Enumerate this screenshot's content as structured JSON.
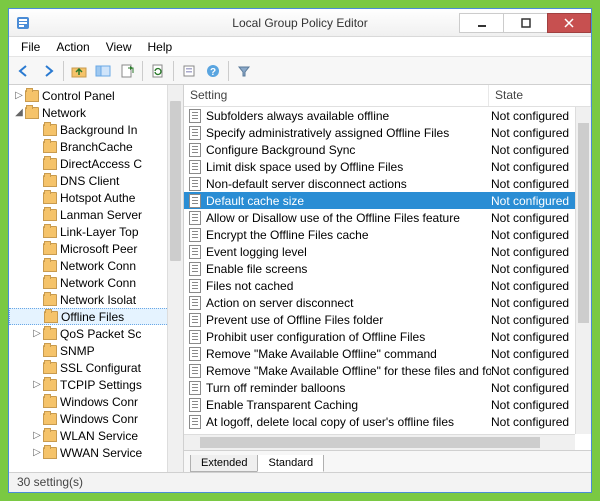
{
  "title": "Local Group Policy Editor",
  "menu": {
    "file": "File",
    "action": "Action",
    "view": "View",
    "help": "Help"
  },
  "toolbar": {
    "back": "back",
    "forward": "forward",
    "up": "up-folder",
    "show": "show-pane",
    "export": "export-list",
    "refresh": "refresh",
    "props": "properties",
    "help": "help",
    "filter": "filter"
  },
  "tree": {
    "items": [
      {
        "label": "Control Panel",
        "exp": "closed",
        "depth": 0,
        "sel": false
      },
      {
        "label": "Network",
        "exp": "open",
        "depth": 0,
        "sel": false
      },
      {
        "label": "Background In",
        "exp": "none",
        "depth": 1,
        "sel": false
      },
      {
        "label": "BranchCache",
        "exp": "none",
        "depth": 1,
        "sel": false
      },
      {
        "label": "DirectAccess C",
        "exp": "none",
        "depth": 1,
        "sel": false
      },
      {
        "label": "DNS Client",
        "exp": "none",
        "depth": 1,
        "sel": false
      },
      {
        "label": "Hotspot Authe",
        "exp": "none",
        "depth": 1,
        "sel": false
      },
      {
        "label": "Lanman Server",
        "exp": "none",
        "depth": 1,
        "sel": false
      },
      {
        "label": "Link-Layer Top",
        "exp": "none",
        "depth": 1,
        "sel": false
      },
      {
        "label": "Microsoft Peer",
        "exp": "none",
        "depth": 1,
        "sel": false
      },
      {
        "label": "Network Conn",
        "exp": "none",
        "depth": 1,
        "sel": false
      },
      {
        "label": "Network Conn",
        "exp": "none",
        "depth": 1,
        "sel": false
      },
      {
        "label": "Network Isolat",
        "exp": "none",
        "depth": 1,
        "sel": false
      },
      {
        "label": "Offline Files",
        "exp": "none",
        "depth": 1,
        "sel": true
      },
      {
        "label": "QoS Packet Sc",
        "exp": "closed",
        "depth": 1,
        "sel": false
      },
      {
        "label": "SNMP",
        "exp": "none",
        "depth": 1,
        "sel": false
      },
      {
        "label": "SSL Configurat",
        "exp": "none",
        "depth": 1,
        "sel": false
      },
      {
        "label": "TCPIP Settings",
        "exp": "closed",
        "depth": 1,
        "sel": false
      },
      {
        "label": "Windows Conr",
        "exp": "none",
        "depth": 1,
        "sel": false
      },
      {
        "label": "Windows Conr",
        "exp": "none",
        "depth": 1,
        "sel": false
      },
      {
        "label": "WLAN Service",
        "exp": "closed",
        "depth": 1,
        "sel": false
      },
      {
        "label": "WWAN Service",
        "exp": "closed",
        "depth": 1,
        "sel": false
      }
    ]
  },
  "columns": {
    "setting": "Setting",
    "state": "State"
  },
  "rows": [
    {
      "name": "Subfolders always available offline",
      "state": "Not configured",
      "sel": false
    },
    {
      "name": "Specify administratively assigned Offline Files",
      "state": "Not configured",
      "sel": false
    },
    {
      "name": "Configure Background Sync",
      "state": "Not configured",
      "sel": false
    },
    {
      "name": "Limit disk space used by Offline Files",
      "state": "Not configured",
      "sel": false
    },
    {
      "name": "Non-default server disconnect actions",
      "state": "Not configured",
      "sel": false
    },
    {
      "name": "Default cache size",
      "state": "Not configured",
      "sel": true
    },
    {
      "name": "Allow or Disallow use of the Offline Files feature",
      "state": "Not configured",
      "sel": false
    },
    {
      "name": "Encrypt the Offline Files cache",
      "state": "Not configured",
      "sel": false
    },
    {
      "name": "Event logging level",
      "state": "Not configured",
      "sel": false
    },
    {
      "name": "Enable file screens",
      "state": "Not configured",
      "sel": false
    },
    {
      "name": "Files not cached",
      "state": "Not configured",
      "sel": false
    },
    {
      "name": "Action on server disconnect",
      "state": "Not configured",
      "sel": false
    },
    {
      "name": "Prevent use of Offline Files folder",
      "state": "Not configured",
      "sel": false
    },
    {
      "name": "Prohibit user configuration of Offline Files",
      "state": "Not configured",
      "sel": false
    },
    {
      "name": "Remove \"Make Available Offline\" command",
      "state": "Not configured",
      "sel": false
    },
    {
      "name": "Remove \"Make Available Offline\" for these files and folders",
      "state": "Not configured",
      "sel": false
    },
    {
      "name": "Turn off reminder balloons",
      "state": "Not configured",
      "sel": false
    },
    {
      "name": "Enable Transparent Caching",
      "state": "Not configured",
      "sel": false
    },
    {
      "name": "At logoff, delete local copy of user's offline files",
      "state": "Not configured",
      "sel": false
    }
  ],
  "tabs": {
    "extended": "Extended",
    "standard": "Standard"
  },
  "status": "30 setting(s)"
}
